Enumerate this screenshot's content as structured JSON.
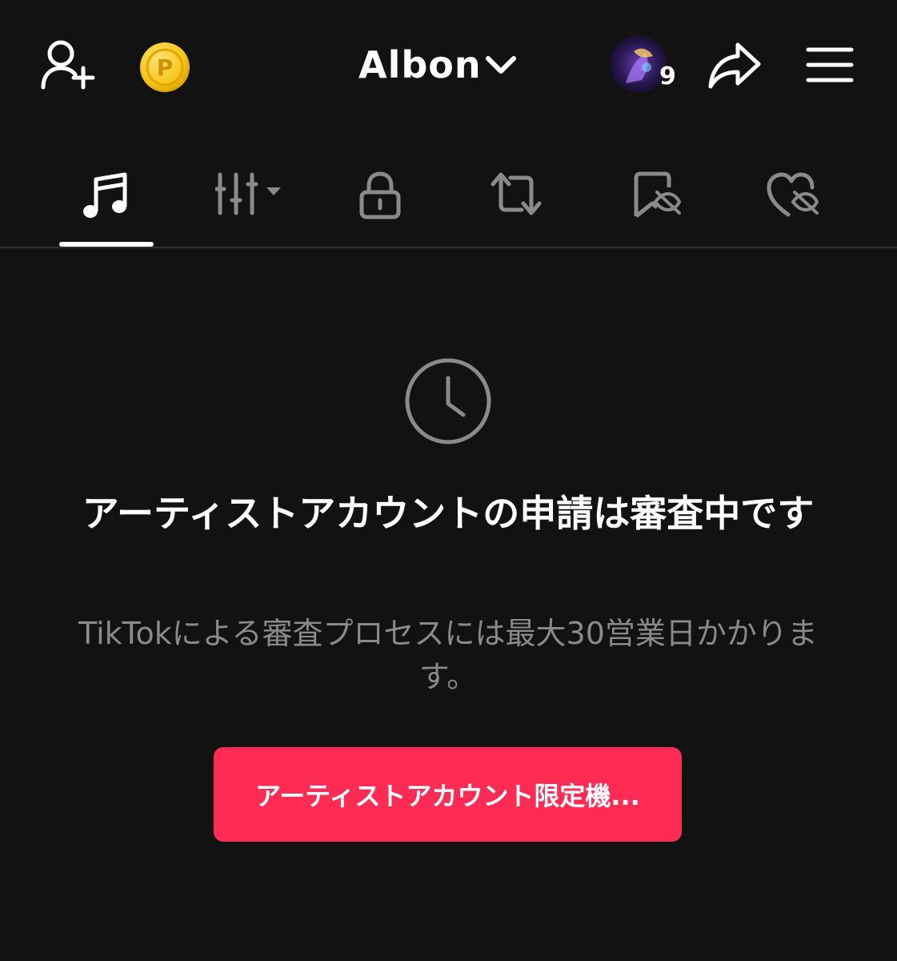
{
  "header": {
    "username": "Albon",
    "avatar_badge_count": "9",
    "icons": [
      "add-user-icon",
      "coin-icon",
      "chevron-down-icon",
      "share-icon",
      "menu-icon"
    ],
    "coin_letter": "P"
  },
  "tabs": [
    {
      "name": "music",
      "icon": "music-note-icon",
      "active": true
    },
    {
      "name": "playlist",
      "icon": "grid-dropdown-icon",
      "active": false
    },
    {
      "name": "private",
      "icon": "lock-icon",
      "active": false
    },
    {
      "name": "reposts",
      "icon": "repost-icon",
      "active": false
    },
    {
      "name": "favorites",
      "icon": "bookmark-hidden-icon",
      "active": false
    },
    {
      "name": "liked",
      "icon": "heart-hidden-icon",
      "active": false
    }
  ],
  "status": {
    "icon": "clock-icon",
    "title": "アーティストアカウントの申請は審査中です",
    "subtitle": "TikTokによる審査プロセスには最大30営業日かかります。"
  },
  "cta": {
    "label": "アーティストアカウント限定機..."
  },
  "colors": {
    "background": "#121212",
    "accent": "#fe2c55",
    "muted_text": "#8a8a8a",
    "inactive_icon": "#8a8a8a",
    "coin": "#f5c518"
  }
}
